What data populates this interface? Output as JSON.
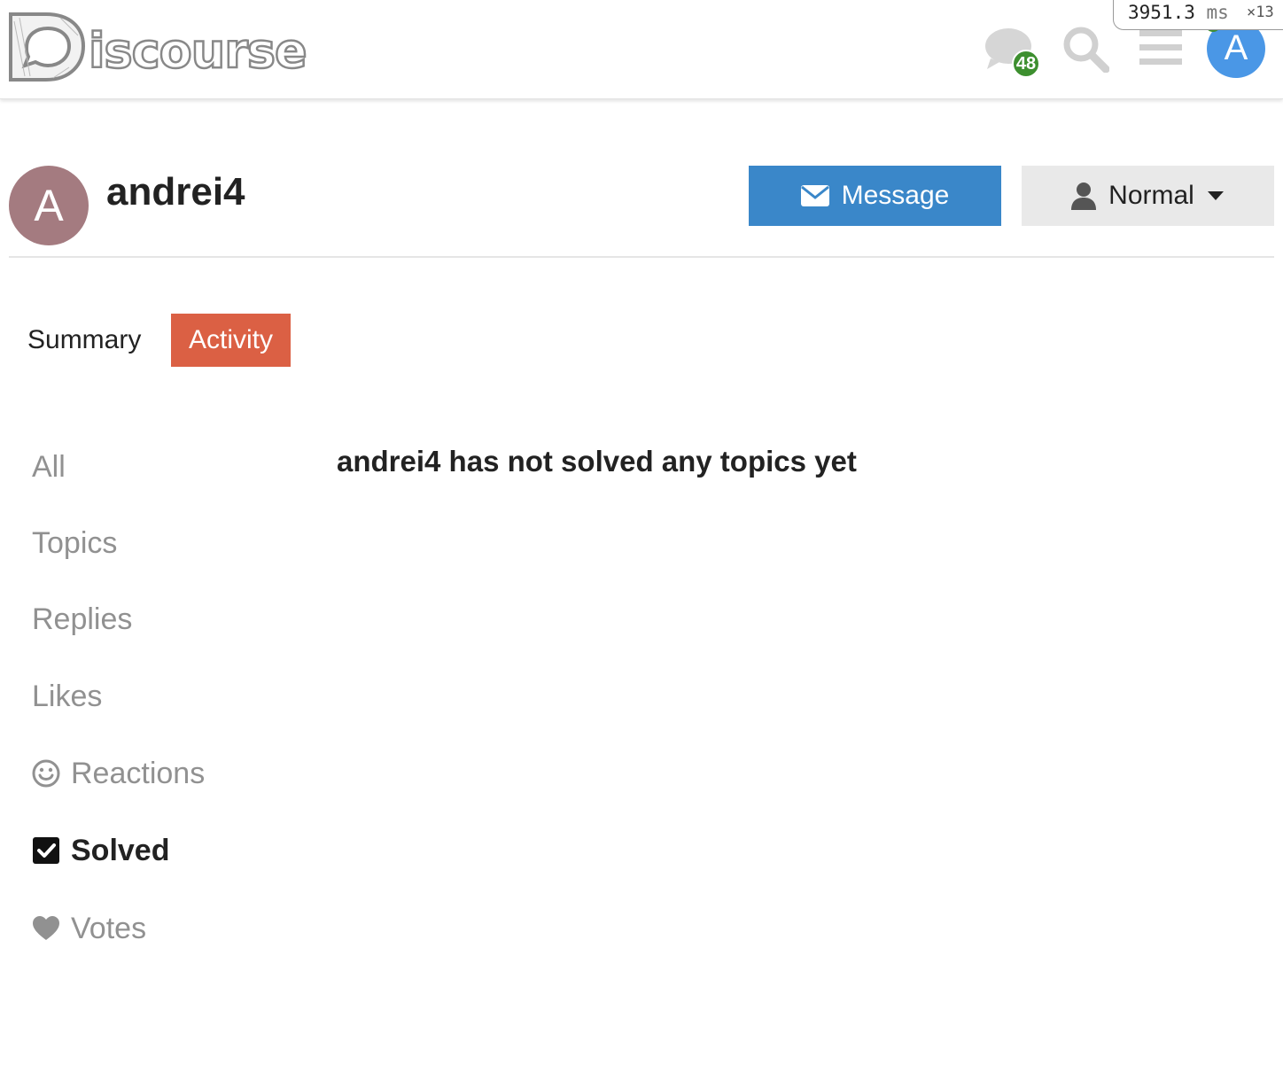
{
  "header": {
    "notification_count": "48",
    "user_initial": "A",
    "timer_value": "3951.3",
    "timer_unit": "ms",
    "timer_multiplier": "×13"
  },
  "profile": {
    "avatar_initial": "A",
    "username": "andrei4",
    "message_button": "Message",
    "level_button": "Normal"
  },
  "tabs": {
    "summary": "Summary",
    "activity": "Activity"
  },
  "sidenav": {
    "all": "All",
    "topics": "Topics",
    "replies": "Replies",
    "likes": "Likes",
    "reactions": "Reactions",
    "solved": "Solved",
    "votes": "Votes"
  },
  "main": {
    "empty_message": "andrei4 has not solved any topics yet"
  },
  "colors": {
    "accent": "#db6044",
    "primary_button": "#3a87c9",
    "badge_green": "#3d8f2f",
    "user_avatar": "#4a97e6",
    "profile_avatar": "#a47b80"
  }
}
